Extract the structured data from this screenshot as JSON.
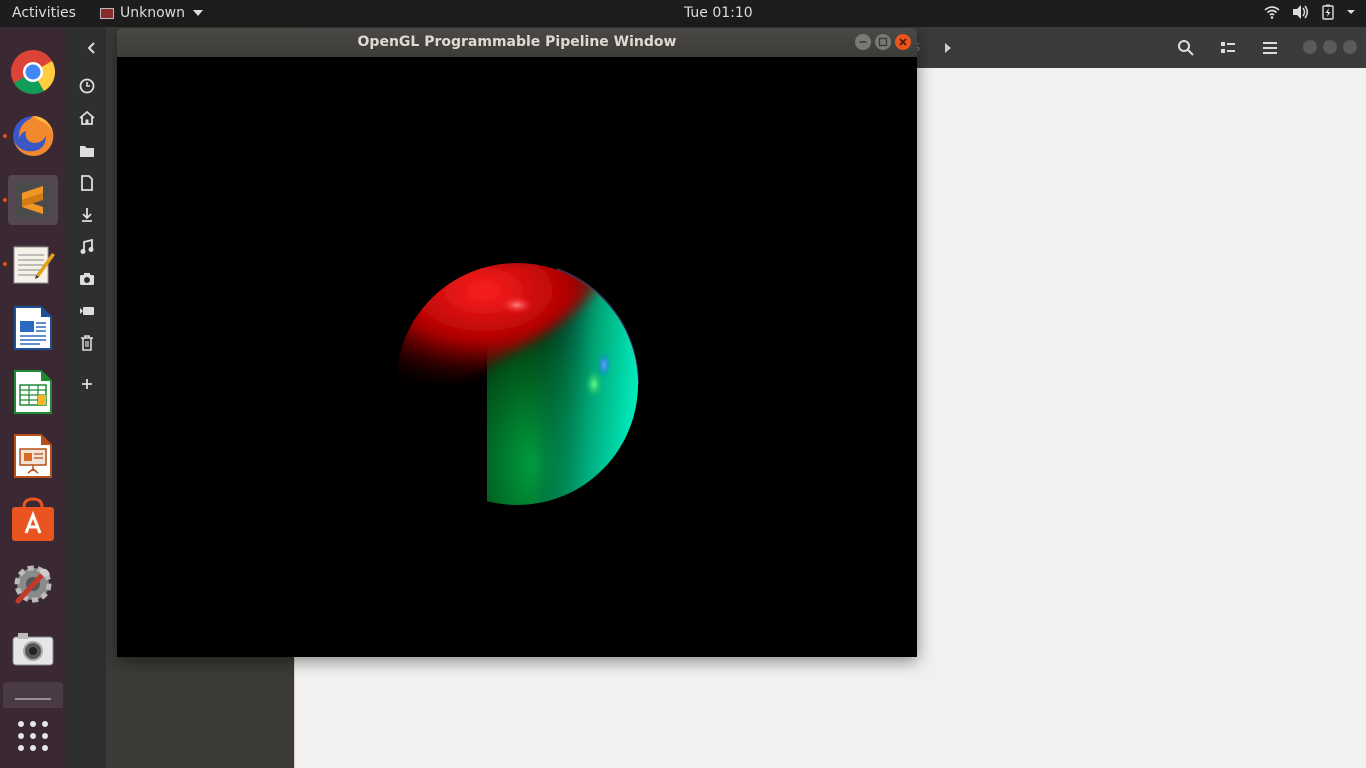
{
  "topbar": {
    "activities": "Activities",
    "app_name": "Unknown",
    "clock": "Tue 01:10"
  },
  "dock": {
    "items": [
      "chrome",
      "firefox",
      "sublime-text",
      "text-editor",
      "libreoffice-writer",
      "libreoffice-calc",
      "libreoffice-impress",
      "software-center",
      "system-settings",
      "screenshot"
    ]
  },
  "files": {
    "partial_label": "s"
  },
  "window": {
    "title": "OpenGL Programmable Pipeline Window"
  },
  "colors": {
    "accent": "#e9541f",
    "dock_bg": "#3a2933",
    "topbar_bg": "#1d1d1d"
  }
}
